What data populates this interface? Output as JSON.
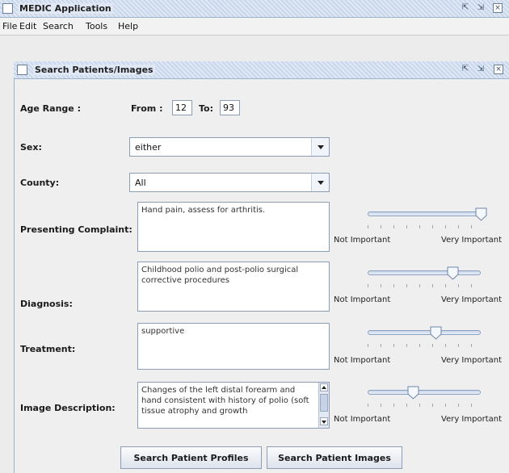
{
  "app": {
    "title": "MEDIC Application",
    "menu": [
      "File",
      "Edit",
      "Search",
      "Tools",
      "Help"
    ]
  },
  "search_window": {
    "title": "Search Patients/Images",
    "age_range": {
      "label": "Age Range :",
      "from_label": "From :",
      "from_value": "12",
      "to_label": "To:",
      "to_value": "93"
    },
    "sex": {
      "label": "Sex:",
      "value": "either"
    },
    "county": {
      "label": "County:",
      "value": "All"
    },
    "criteria": [
      {
        "label": "Presenting Complaint:",
        "text": "Hand pain, assess for arthritis.",
        "importance": 1.0
      },
      {
        "label": "Diagnosis:",
        "text": "Childhood polio and post-polio surgical corrective procedures",
        "importance": 0.75
      },
      {
        "label": "Treatment:",
        "text": "supportive",
        "importance": 0.6
      },
      {
        "label": "Image Description:",
        "text": "Changes of the left distal forearm and hand consistent with history of polio (soft tissue atrophy and growth",
        "importance": 0.4
      }
    ],
    "scale_min_label": "Not Important",
    "scale_max_label": "Very Important",
    "buttons": {
      "search_profiles": "Search Patient Profiles",
      "search_images": "Search Patient Images"
    }
  },
  "window_controls": {
    "restore": "⇱",
    "maximize": "⇲",
    "close": "×"
  },
  "colors": {
    "titlebar": "#c9d7ea",
    "slider_track": "#c8d6ea",
    "border": "#8c9db5"
  }
}
